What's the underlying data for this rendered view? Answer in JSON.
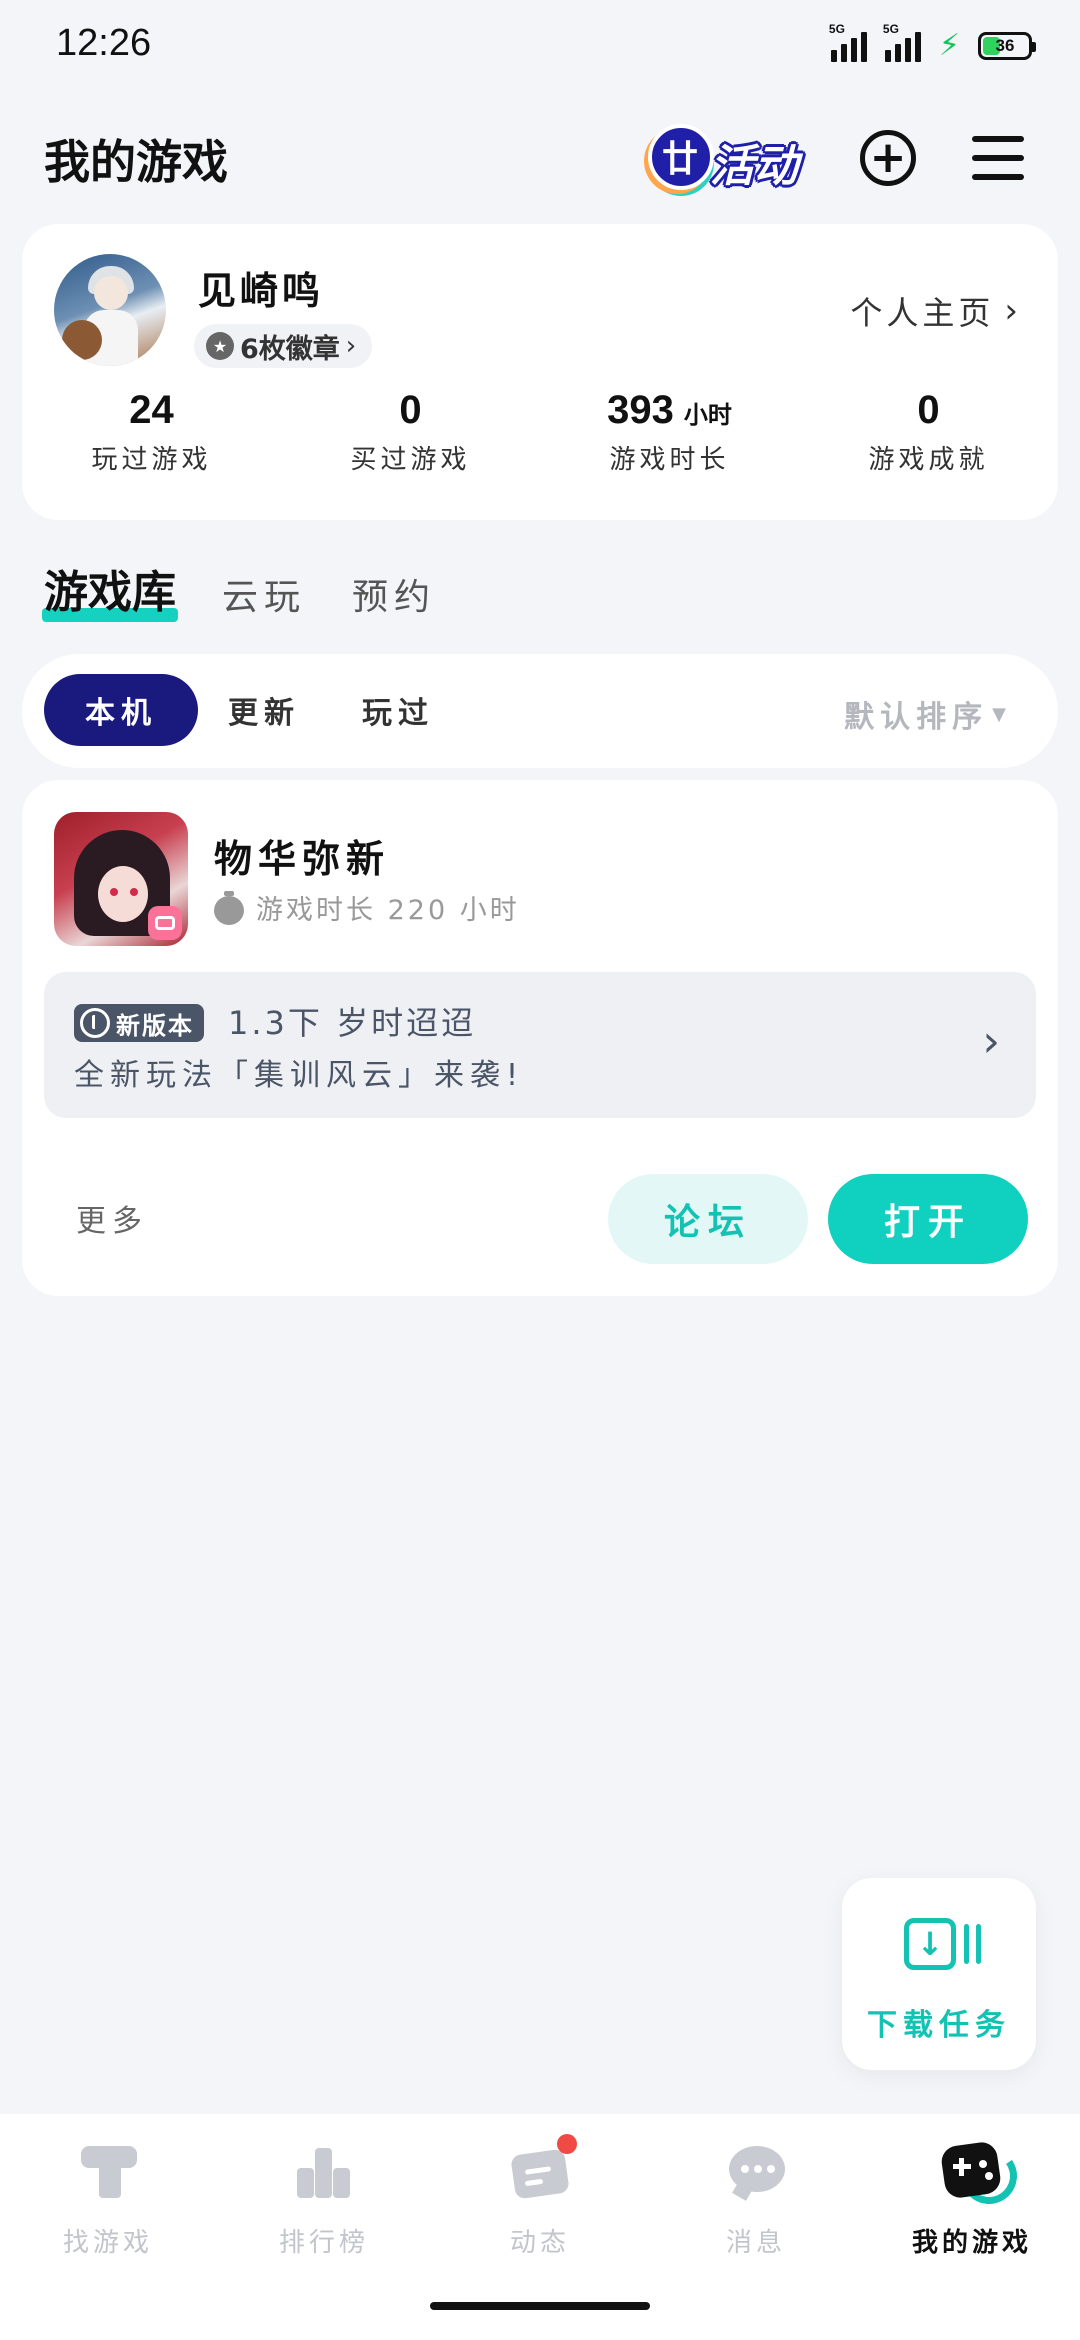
{
  "status_bar": {
    "time": "12:26",
    "signal_1": "5G",
    "signal_2": "5G",
    "battery": "36"
  },
  "header": {
    "title": "我的游戏",
    "activity_label": "活动"
  },
  "profile": {
    "name": "见崎鸣",
    "badges": "6枚徽章",
    "homepage_link": "个人主页",
    "stats": [
      {
        "value": "24",
        "unit": "",
        "label": "玩过游戏"
      },
      {
        "value": "0",
        "unit": "",
        "label": "买过游戏"
      },
      {
        "value": "393",
        "unit": "小时",
        "label": "游戏时长"
      },
      {
        "value": "0",
        "unit": "",
        "label": "游戏成就"
      }
    ]
  },
  "library_tabs": [
    {
      "label": "游戏库",
      "active": true
    },
    {
      "label": "云玩",
      "active": false
    },
    {
      "label": "预约",
      "active": false
    }
  ],
  "filters": {
    "chips": [
      {
        "label": "本机",
        "active": true
      },
      {
        "label": "更新",
        "active": false
      },
      {
        "label": "玩过",
        "active": false
      }
    ],
    "sort": "默认排序"
  },
  "game": {
    "name": "物华弥新",
    "playtime": "游戏时长 220 小时",
    "update": {
      "tag": "新版本",
      "line1": "1.3下 岁时迢迢",
      "line2": "全新玩法「集训风云」来袭!"
    },
    "more": "更多",
    "forum_button": "论坛",
    "open_button": "打开"
  },
  "download": {
    "label": "下载任务"
  },
  "bottom_nav": [
    {
      "label": "找游戏",
      "icon": "find-games-icon",
      "active": false
    },
    {
      "label": "排行榜",
      "icon": "ranking-icon",
      "active": false
    },
    {
      "label": "动态",
      "icon": "feed-icon",
      "active": false
    },
    {
      "label": "消息",
      "icon": "message-icon",
      "active": false
    },
    {
      "label": "我的游戏",
      "icon": "my-games-icon",
      "active": true
    }
  ],
  "colors": {
    "accent": "#10d0c0",
    "active_chip": "#1a1a7e",
    "notification": "#f04a45"
  }
}
